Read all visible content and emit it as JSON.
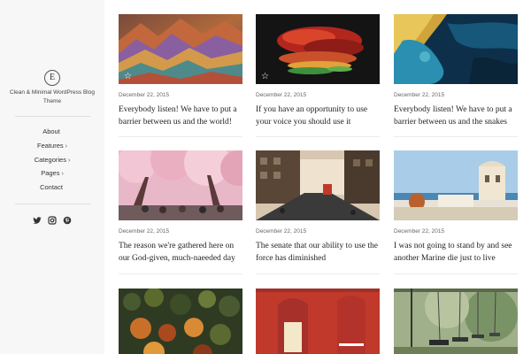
{
  "sidebar": {
    "logo_letter": "E",
    "tagline": "Clean & Minimal WordPress Blog Theme",
    "nav": [
      {
        "label": "About",
        "chevron": ""
      },
      {
        "label": "Features",
        "chevron": "›"
      },
      {
        "label": "Categories",
        "chevron": "›"
      },
      {
        "label": "Pages",
        "chevron": "›"
      },
      {
        "label": "Contact",
        "chevron": ""
      }
    ],
    "social_icons": [
      "twitter-icon",
      "instagram-icon",
      "pinterest-icon"
    ]
  },
  "posts": [
    {
      "date": "December 22, 2015",
      "title": "Everybody listen! We have to put a barrier between us and the world!",
      "image": "colorful-mountains",
      "sticky": true
    },
    {
      "date": "December 22, 2015",
      "title": "If you have an opportunity to use your voice you should use it",
      "image": "red-coral-abstract",
      "sticky": true
    },
    {
      "date": "December 22, 2015",
      "title": "Everybody listen! We have to put a barrier between us and the snakes",
      "image": "aerial-coastline",
      "sticky": false
    },
    {
      "date": "December 22, 2015",
      "title": "The reason we're gathered here on our God-given, much-naeeded day",
      "image": "cherry-blossom-street",
      "sticky": false
    },
    {
      "date": "December 22, 2015",
      "title": "The senate that our ability to use the force has diminished",
      "image": "city-street-bus",
      "sticky": false
    },
    {
      "date": "December 22, 2015",
      "title": "I was not going to stand by and see another Marine die just to live",
      "image": "white-village-sea",
      "sticky": false
    },
    {
      "date": "",
      "title": "",
      "image": "autumn-forest-aerial",
      "sticky": false
    },
    {
      "date": "",
      "title": "",
      "image": "red-wall-doors",
      "sticky": false
    },
    {
      "date": "",
      "title": "",
      "image": "park-swings",
      "sticky": false
    }
  ]
}
